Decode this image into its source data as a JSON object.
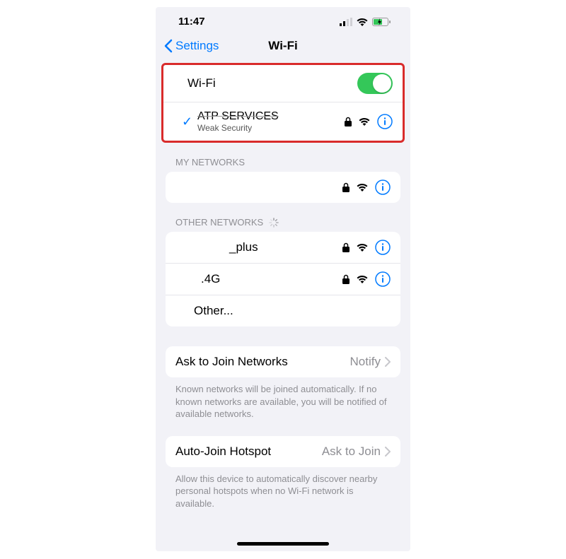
{
  "status_bar": {
    "time": "11:47"
  },
  "nav": {
    "back": "Settings",
    "title": "Wi-Fi"
  },
  "wifi": {
    "toggle_label": "Wi-Fi",
    "connected": {
      "name": "ATP SERVICES",
      "subtitle": "Weak Security"
    }
  },
  "sections": {
    "my_networks_header": "MY NETWORKS",
    "my_networks": [
      {
        "name": ""
      }
    ],
    "other_networks_header": "OTHER NETWORKS",
    "other_networks": [
      {
        "name": "_plus"
      },
      {
        "name": ".4G"
      }
    ],
    "other_label": "Other..."
  },
  "ask_join": {
    "label": "Ask to Join Networks",
    "value": "Notify",
    "footer": "Known networks will be joined automatically. If no known networks are available, you will be notified of available networks."
  },
  "auto_join": {
    "label": "Auto-Join Hotspot",
    "value": "Ask to Join",
    "footer": "Allow this device to automatically discover nearby personal hotspots when no Wi-Fi network is available."
  }
}
